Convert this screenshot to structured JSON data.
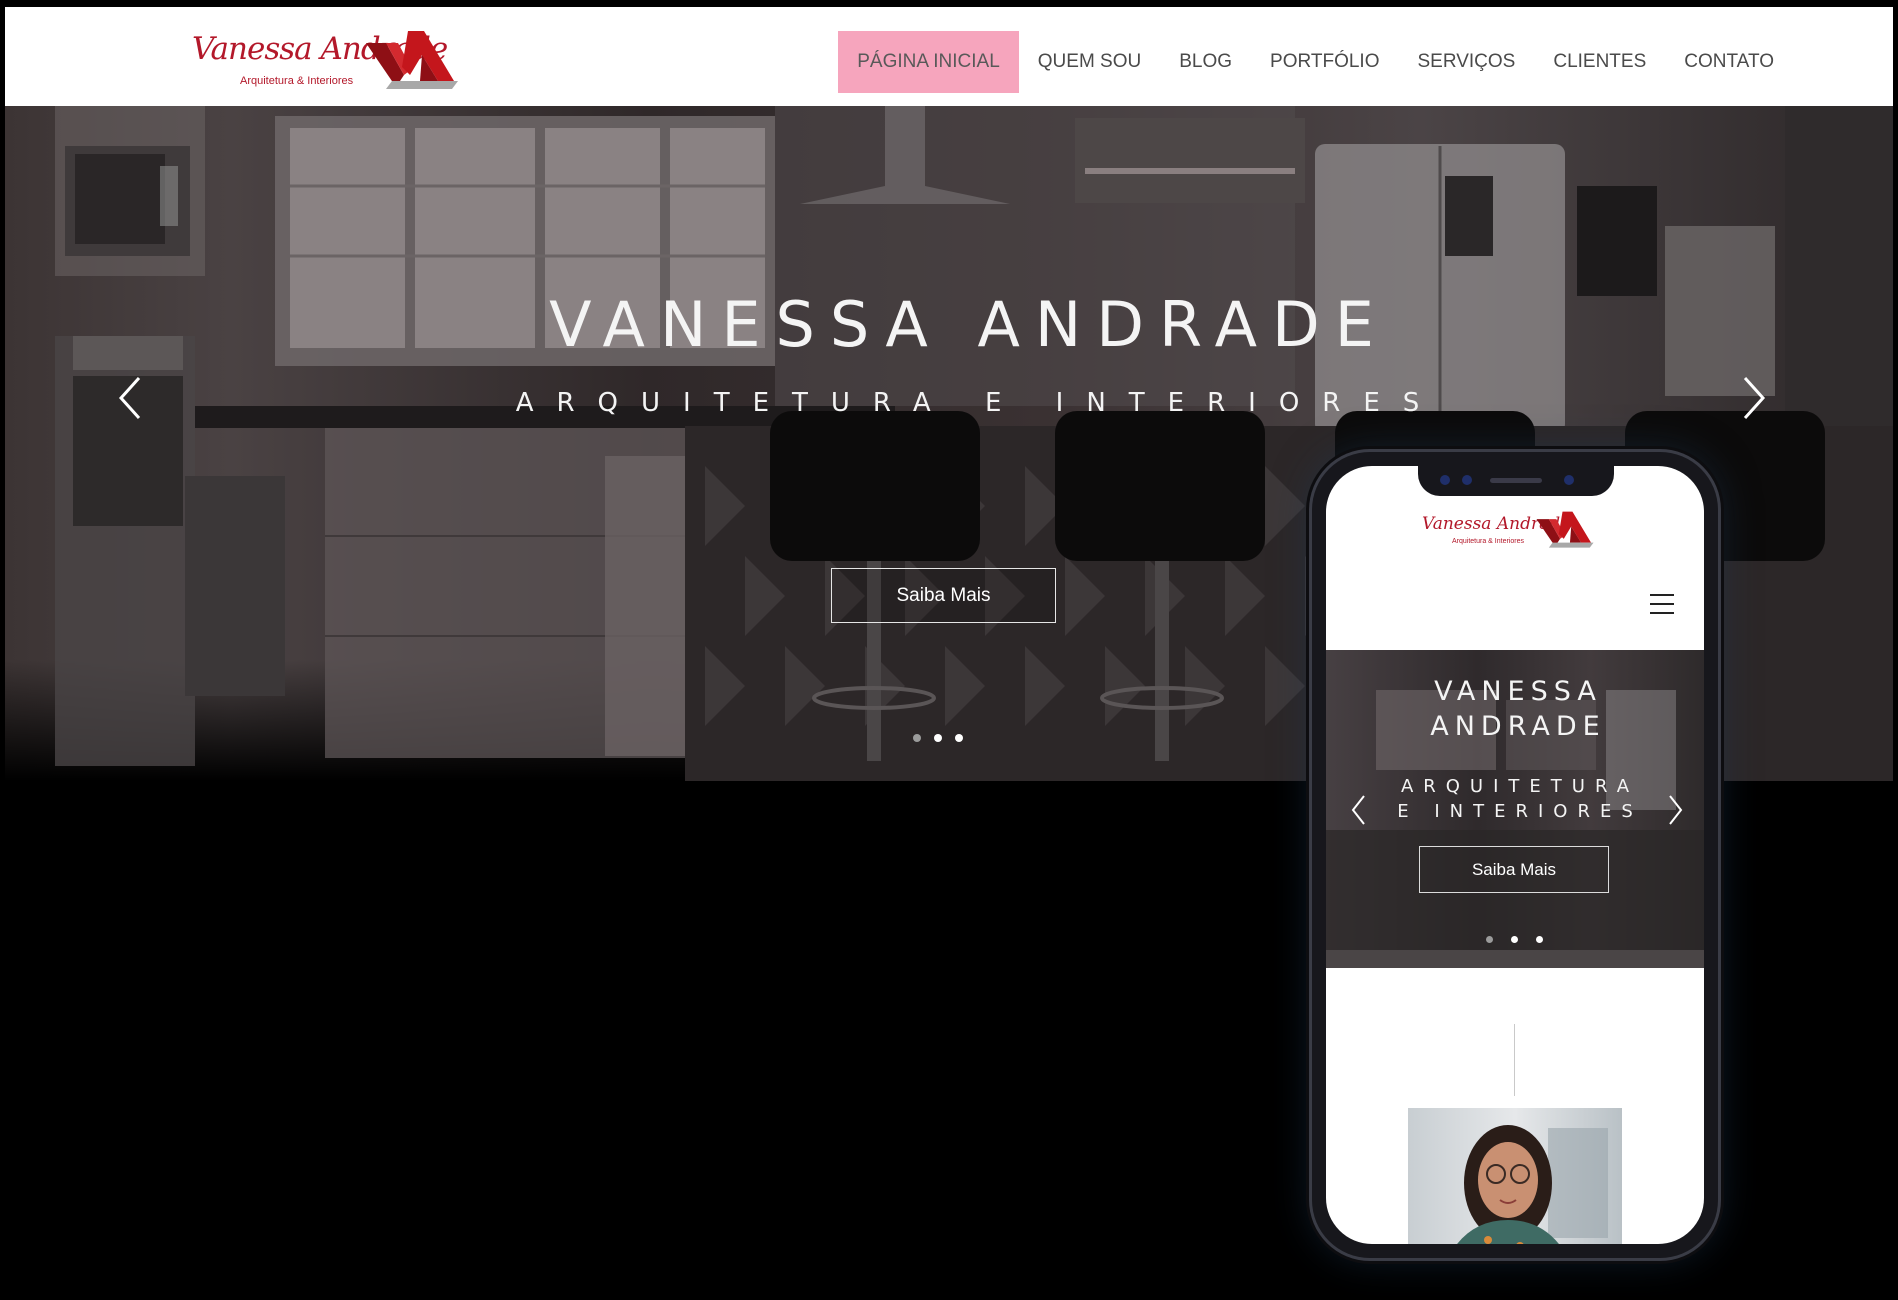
{
  "header": {
    "logo": {
      "script": "Vanessa Andrade",
      "sub": "Arquitetura & Interiores",
      "mark": "VA"
    },
    "nav": [
      {
        "label": "PÁGINA INICIAL",
        "active": true
      },
      {
        "label": "QUEM SOU"
      },
      {
        "label": "BLOG"
      },
      {
        "label": "PORTFÓLIO"
      },
      {
        "label": "SERVIÇOS"
      },
      {
        "label": "CLIENTES"
      },
      {
        "label": "CONTATO"
      }
    ],
    "active_color": "#f6a5bd"
  },
  "hero": {
    "title": "VANESSA ANDRADE",
    "subtitle": "ARQUITETURA E INTERIORES",
    "button": "Saiba Mais",
    "prev_icon": "chevron-left-icon",
    "next_icon": "chevron-right-icon",
    "slides": 3,
    "active_slide": 2
  },
  "mobile": {
    "logo": {
      "script": "Vanessa Andrade",
      "sub": "Arquitetura & Interiores",
      "mark": "VA"
    },
    "menu_icon": "hamburger-menu-icon",
    "title_line1": "VANESSA",
    "title_line2": "ANDRADE",
    "subtitle_line1": "ARQUITETURA",
    "subtitle_line2": "E INTERIORES",
    "button": "Saiba Mais",
    "slides": 3,
    "active_slide": 2
  },
  "brand_red": "#c4161c"
}
